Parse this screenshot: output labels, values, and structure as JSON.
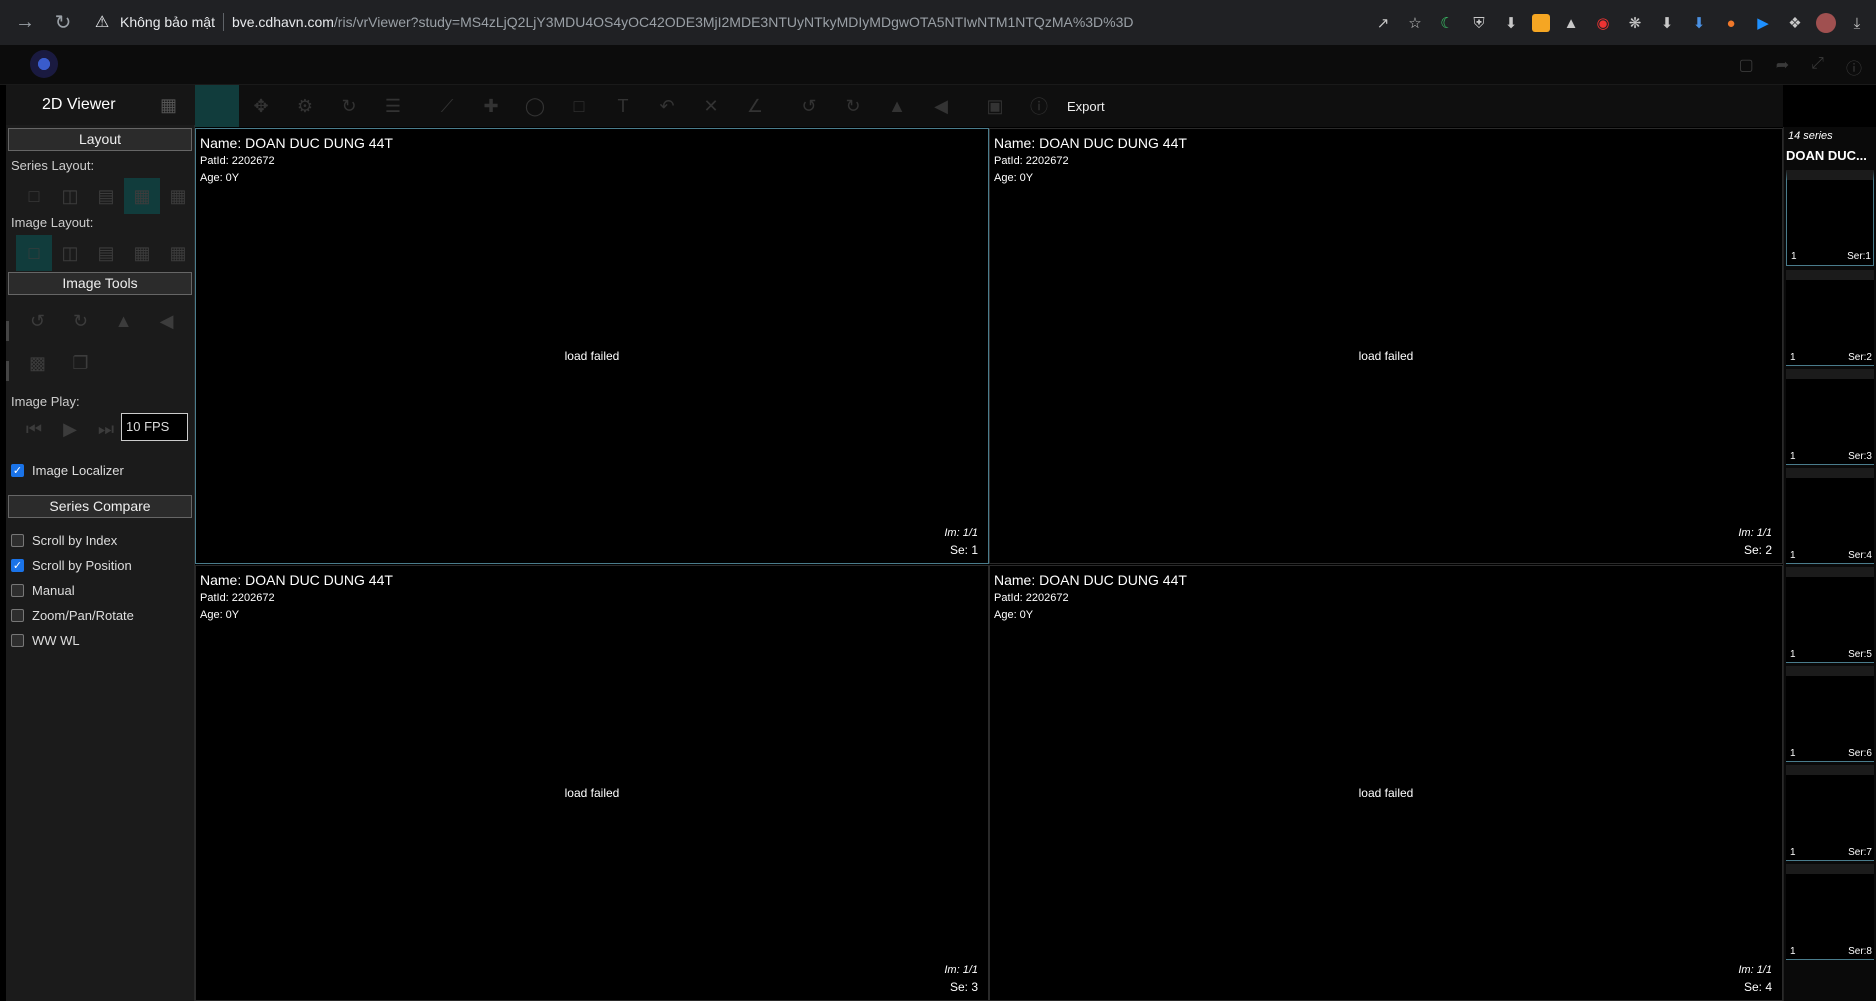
{
  "browser": {
    "security_label": "Không bảo mật",
    "url_host": "bve.cdhavn.com",
    "url_path": "/ris/vrViewer?study=MS4zLjQ2LjY3MDU4OS4yOC42ODE3MjI2MDE3NTUyNTkyMDIyMDgwOTA5NTIwNTM1NTQzMA%3D%3D"
  },
  "app": {
    "viewer_title": "2D Viewer"
  },
  "left_panel": {
    "layout_header": "Layout",
    "series_layout_label": "Series Layout:",
    "image_layout_label": "Image Layout:",
    "image_tools_header": "Image Tools",
    "image_play_label": "Image Play:",
    "fps_value": "10 FPS",
    "image_localizer_label": "Image Localizer",
    "image_localizer_checked": true,
    "series_compare_header": "Series Compare",
    "compare_options": [
      {
        "label": "Scroll by Index",
        "checked": false
      },
      {
        "label": "Scroll by Position",
        "checked": true
      },
      {
        "label": "Manual",
        "checked": false
      },
      {
        "label": "Zoom/Pan/Rotate",
        "checked": false
      },
      {
        "label": "WW WL",
        "checked": false
      }
    ]
  },
  "toolbar": {
    "export_label": "Export"
  },
  "viewports": [
    {
      "name": "Name: DOAN DUC DUNG 44T",
      "patient_id": "PatId: 2202672",
      "age": "Age: 0Y",
      "status": "load failed",
      "image_index": "Im: 1/1",
      "series": "Se: 1"
    },
    {
      "name": "Name: DOAN DUC DUNG 44T",
      "patient_id": "PatId: 2202672",
      "age": "Age: 0Y",
      "status": "load failed",
      "image_index": "Im: 1/1",
      "series": "Se: 2"
    },
    {
      "name": "Name: DOAN DUC DUNG 44T",
      "patient_id": "PatId: 2202672",
      "age": "Age: 0Y",
      "status": "load failed",
      "image_index": "Im: 1/1",
      "series": "Se: 3"
    },
    {
      "name": "Name: DOAN DUC DUNG 44T",
      "patient_id": "PatId: 2202672",
      "age": "Age: 0Y",
      "status": "load failed",
      "image_index": "Im: 1/1",
      "series": "Se: 4"
    }
  ],
  "series_panel": {
    "count_label": "14 series",
    "patient_label": "DOAN DUC...",
    "thumbnails": [
      {
        "index": "1",
        "series": "Ser:1"
      },
      {
        "index": "1",
        "series": "Ser:2"
      },
      {
        "index": "1",
        "series": "Ser:3"
      },
      {
        "index": "1",
        "series": "Ser:4"
      },
      {
        "index": "1",
        "series": "Ser:5"
      },
      {
        "index": "1",
        "series": "Ser:6"
      },
      {
        "index": "1",
        "series": "Ser:7"
      },
      {
        "index": "1",
        "series": "Ser:8"
      }
    ]
  }
}
